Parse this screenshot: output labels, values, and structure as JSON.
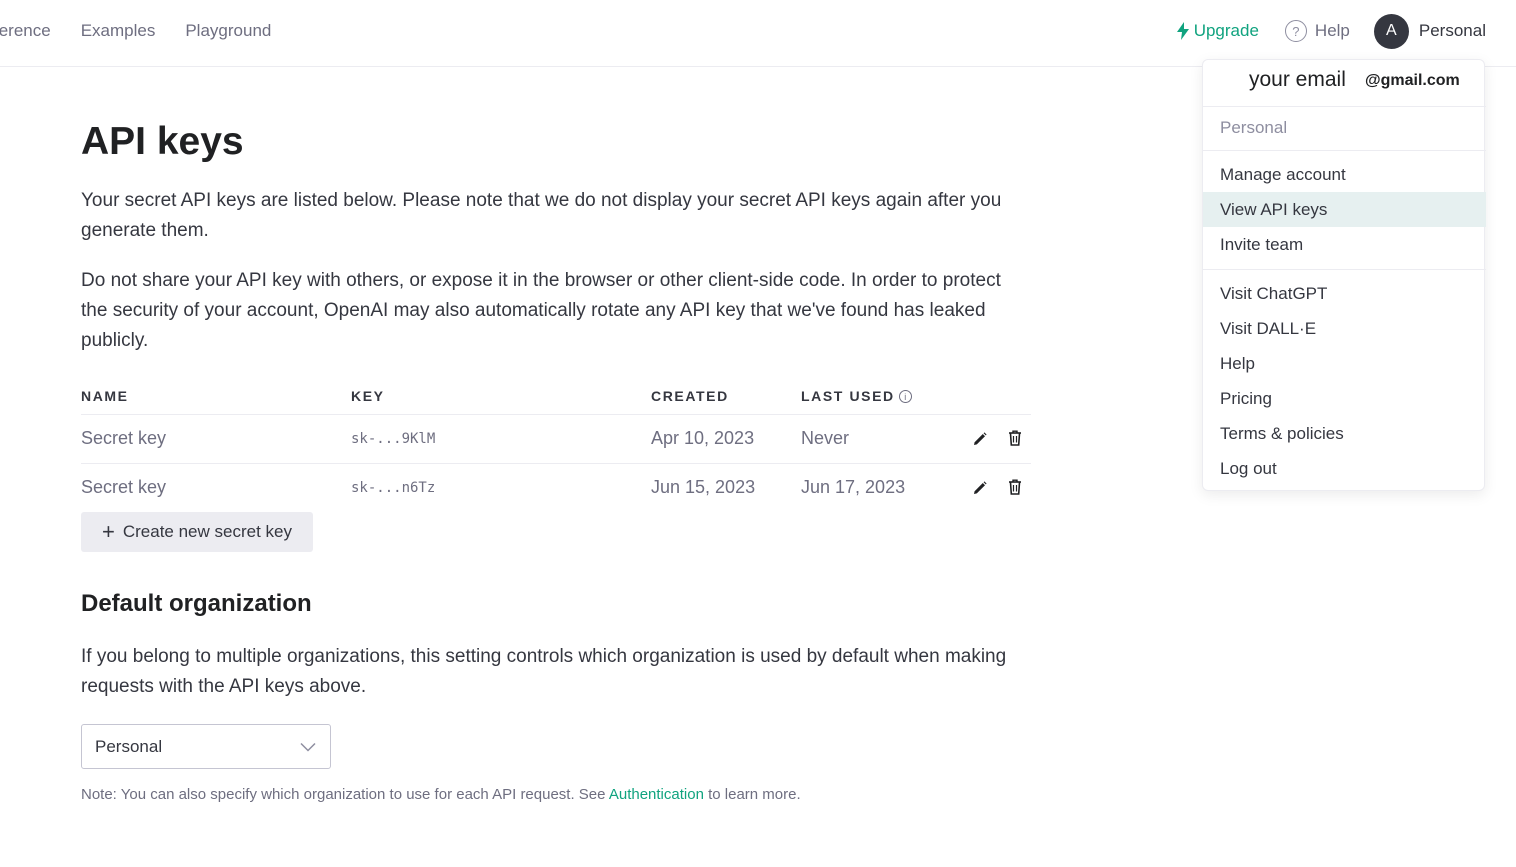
{
  "nav": {
    "links": [
      "ference",
      "Examples",
      "Playground"
    ],
    "upgrade": "Upgrade",
    "help": "Help",
    "help_icon": "?",
    "avatar_letter": "A",
    "account": "Personal"
  },
  "page": {
    "title": "API keys",
    "intro": "Your secret API keys are listed below. Please note that we do not display your secret API keys again after you generate them.",
    "warning": "Do not share your API key with others, or expose it in the browser or other client-side code. In order to protect the security of your account, OpenAI may also automatically rotate any API key that we've found has leaked publicly."
  },
  "table": {
    "headers": {
      "name": "NAME",
      "key": "KEY",
      "created": "CREATED",
      "last_used": "LAST USED"
    },
    "info_icon": "i",
    "rows": [
      {
        "name": "Secret key",
        "key": "sk-...9KlM",
        "created": "Apr 10, 2023",
        "last_used": "Never"
      },
      {
        "name": "Secret key",
        "key": "sk-...n6Tz",
        "created": "Jun 15, 2023",
        "last_used": "Jun 17, 2023"
      }
    ]
  },
  "create_button": {
    "plus": "+",
    "label": "Create new secret key"
  },
  "default_org": {
    "heading": "Default organization",
    "description": "If you belong to multiple organizations, this setting controls which organization is used by default when making requests with the API keys above.",
    "selected": "Personal",
    "note_prefix": "Note: You can also specify which organization to use for each API request. See ",
    "note_link": "Authentication",
    "note_suffix": " to learn more."
  },
  "dropdown": {
    "email_label": "your email",
    "email_domain": "@gmail.com",
    "org": "Personal",
    "group1": [
      "Manage account",
      "View API keys",
      "Invite team"
    ],
    "group2": [
      "Visit ChatGPT",
      "Visit DALL·E",
      "Help",
      "Pricing",
      "Terms & policies",
      "Log out"
    ],
    "active_item": "View API keys"
  },
  "colors": {
    "accent": "#10a37f",
    "text": "#353740",
    "muted": "#6e6e80",
    "active_bg": "#e6f0f0"
  }
}
